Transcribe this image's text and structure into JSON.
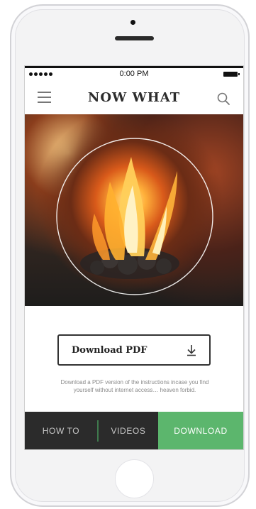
{
  "status_bar": {
    "time": "0:00 PM"
  },
  "header": {
    "title": "NOW WHAT",
    "menu_icon": "hamburger-menu-icon",
    "search_icon": "search-icon"
  },
  "hero": {
    "image": "campfire-flames-photo"
  },
  "download": {
    "button_label": "Download PDF",
    "button_icon": "download-arrow-icon",
    "description": "Download a PDF version of the instructions incase you find yourself without internet access… heaven forbid."
  },
  "tabs": {
    "how_to": "HOW TO",
    "videos": "VIDEOS",
    "download": "DOWNLOAD"
  },
  "colors": {
    "accent_green": "#5cb66d",
    "tabbar_bg": "#2b2b2b",
    "title_text": "#2c2c2c"
  }
}
